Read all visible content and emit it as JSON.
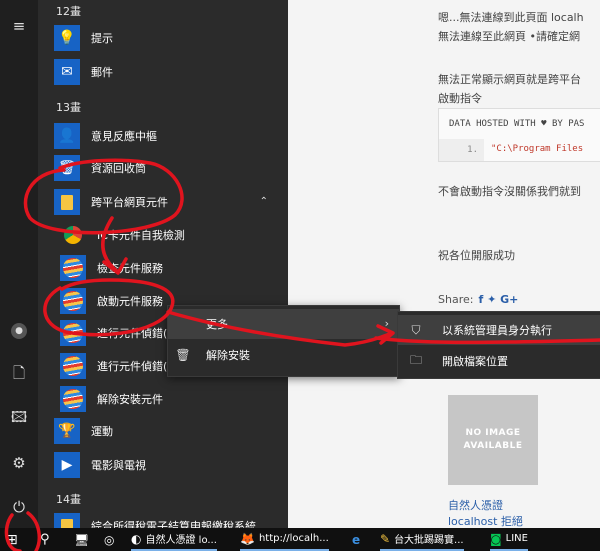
{
  "start_menu": {
    "rail": {
      "hamburger": "≡",
      "user": "●",
      "documents": "🗋",
      "pictures": "🖾",
      "settings": "⚙",
      "power": "⏻"
    },
    "groups": [
      {
        "header": "12畫"
      },
      {
        "header": "13畫"
      },
      {
        "header": "14畫"
      }
    ],
    "apps": [
      {
        "label": "提示",
        "icon": "lightbulb-icon",
        "glyph": "💡"
      },
      {
        "label": "郵件",
        "icon": "mail-icon",
        "glyph": "✉"
      },
      {
        "label": "意見反應中樞",
        "icon": "feedback-icon",
        "glyph": "👤"
      },
      {
        "label": "資源回收筒",
        "icon": "recycle-bin-icon",
        "glyph": "🗑"
      },
      {
        "label": "跨平台網頁元件",
        "icon": "folder-icon",
        "glyph": "📁"
      },
      {
        "label": "IC卡元件自我檢測",
        "icon": "chrome-icon",
        "glyph": "◉"
      },
      {
        "label": "檢查元件服務",
        "icon": "service-icon",
        "glyph": ""
      },
      {
        "label": "啟動元件服務",
        "icon": "service-icon",
        "glyph": ""
      },
      {
        "label": "進行元件偵錯(",
        "icon": "service-icon",
        "glyph": ""
      },
      {
        "label": "進行元件偵錯(",
        "icon": "service-icon",
        "glyph": ""
      },
      {
        "label": "解除安裝元件",
        "icon": "service-icon",
        "glyph": ""
      },
      {
        "label": "運動",
        "icon": "trophy-icon",
        "glyph": "🏆"
      },
      {
        "label": "電影與電視",
        "icon": "movies-icon",
        "glyph": "▶"
      },
      {
        "label": "綜合所得稅電子結算申報繳稅系統",
        "icon": "folder-icon",
        "glyph": "📁"
      }
    ],
    "folder_chevron": "⌃"
  },
  "context_menu": {
    "more_label": "更多",
    "more_arrow": "›",
    "uninstall_label": "解除安裝",
    "uninstall_glyph": "🗑"
  },
  "submenu": {
    "run_as_admin_label": "以系統管理員身分執行",
    "run_as_admin_glyph": "⛉",
    "open_location_label": "開啟檔案位置",
    "open_location_glyph": "🗀"
  },
  "webpage": {
    "line1": "嗯...無法連線到此頁面 localh",
    "line2": "無法連線至此網頁 •請確定網",
    "line3": "無法正常顯示網頁就是跨平台",
    "line4": "啟動指令",
    "code_header": "DATA HOSTED WITH ♥ BY PAS",
    "code_line_num": "1.",
    "code_line": "\"C:\\Program Files",
    "line5": "不會啟動指令沒關係我們就到",
    "line6": "祝各位開服成功",
    "share_label": "Share:",
    "share_icons": "f  ✦  G+",
    "noimage_l1": "NO IMAGE",
    "noimage_l2": "AVAILABLE",
    "link1": "自然人憑證",
    "link2": "localhost 拒絕"
  },
  "taskbar": {
    "start_glyph": "⊞",
    "search_glyph": "⚲",
    "items": [
      {
        "label": "",
        "glyph": "🖥"
      },
      {
        "label": "",
        "glyph": "◎"
      },
      {
        "label": "自然人憑證 lo...",
        "glyph": "◐"
      },
      {
        "label": "http://localh...",
        "glyph": "🦊"
      },
      {
        "label": "",
        "glyph": "e"
      },
      {
        "label": "台大批踢踢實...",
        "glyph": "✎"
      },
      {
        "label": "LINE",
        "glyph": "◙"
      }
    ]
  },
  "colors": {
    "annotation": "#e0141e",
    "accent": "#1763c5"
  }
}
